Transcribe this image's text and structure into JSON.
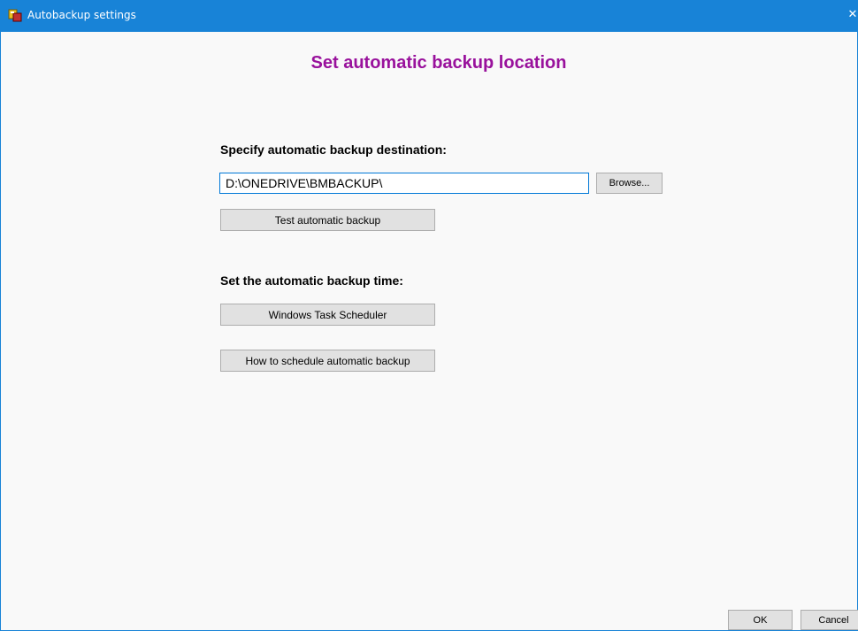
{
  "window": {
    "title": "Autobackup settings",
    "close_glyph": "✕",
    "icon": "autobackup-app-icon"
  },
  "main": {
    "heading": "Set automatic backup location",
    "destination_label": "Specify automatic backup destination:",
    "destination_value": "D:\\ONEDRIVE\\BMBACKUP\\",
    "browse_label": "Browse...",
    "test_label": "Test automatic backup",
    "time_label": "Set the automatic backup time:",
    "scheduler_label": "Windows Task Scheduler",
    "howto_label": "How to schedule automatic backup"
  },
  "footer": {
    "ok_label": "OK",
    "cancel_label": "Cancel"
  },
  "colors": {
    "titlebar": "#1883d7",
    "heading": "#99119c",
    "background": "#f9f9f9"
  }
}
